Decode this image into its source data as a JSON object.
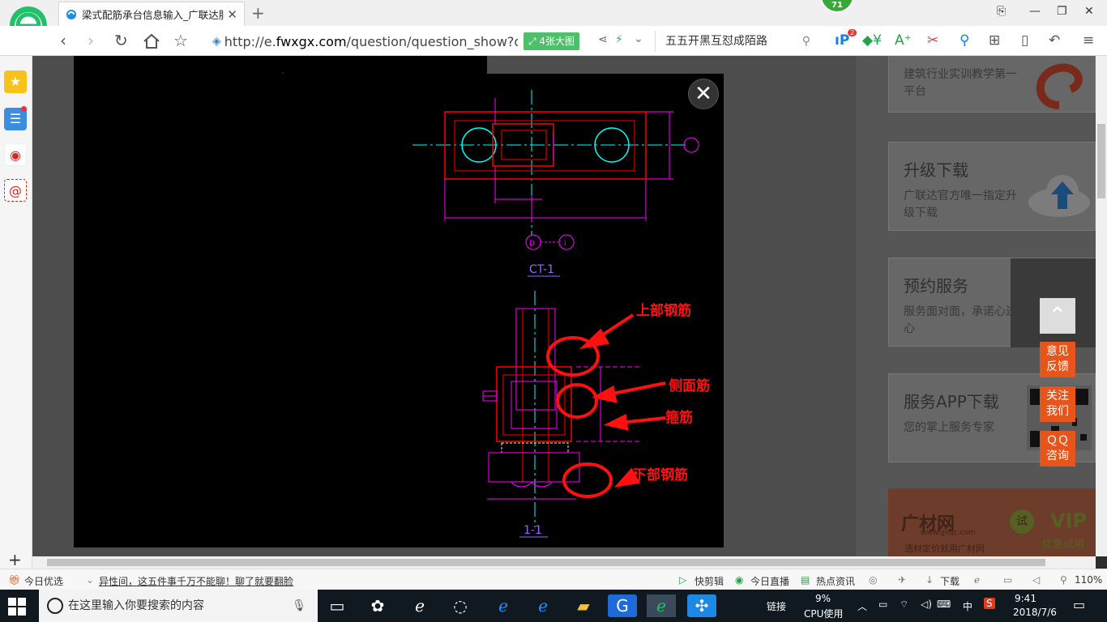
{
  "browser": {
    "tab_title": "梁式配筋承台信息输入_广联达服",
    "tab_close": "✕",
    "new_tab": "+",
    "badge_count": "71",
    "window_controls": [
      "⎘",
      "—",
      "❐",
      "✕"
    ]
  },
  "toolbar": {
    "url_prefix": "http://e.",
    "url_domain": "fwxgx.com",
    "url_rest": "/question/question_show?que",
    "big_image_label": "4张大图",
    "search_text": "五五开黑互怼成陌路",
    "notif_badge": "2"
  },
  "lightbox": {
    "labels": {
      "top_rebar": "上部钢筋",
      "side_rebar": "侧面筋",
      "stirrup": "箍筋",
      "bottom_rebar": "下部钢筋"
    },
    "plan_title": "CT-1",
    "section_title": "1-1",
    "axis_d": "D",
    "axis_i": "i",
    "close": "✕"
  },
  "sidebar_cards": [
    {
      "title": "",
      "desc": "建筑行业实训教学第一平台"
    },
    {
      "title": "升级下载",
      "desc": "广联达官方唯一指定升级下载"
    },
    {
      "title": "预约服务",
      "desc": "服务面对面，承诺心连心"
    },
    {
      "title": "服务APP下载",
      "desc": "您的掌上服务专家"
    }
  ],
  "promo": {
    "brand": "广材网",
    "url": "www.gldjc.com",
    "tagline": "透材定价就用广材网",
    "vip": "VIP",
    "vip_sub": "优惠试用",
    "trial": "试"
  },
  "floating": {
    "feedback": "意见\n反馈",
    "follow": "关注\n我们",
    "qq": "ＱＱ\n咨询"
  },
  "statusbar": {
    "today": "今日优选",
    "news": "异性间，这五件事千万不能聊！聊了就要翻脸",
    "quick_cut": "快剪辑",
    "today_live": "今日直播",
    "hot_news": "热点资讯",
    "download": "下载",
    "zoom": "110%"
  },
  "taskbar": {
    "search_placeholder": "在这里输入你要搜索的内容",
    "link_label": "链接",
    "cpu_percent": "9%",
    "cpu_label": "CPU使用",
    "ime": "中",
    "time": "9:41",
    "date": "2018/7/6"
  },
  "colors": {
    "accent_green": "#4ec06a",
    "annotation_red": "#ff1010",
    "cad_magenta": "#ff00ff",
    "cad_cyan": "#00ffff",
    "cad_red": "#ff0000",
    "float_orange": "#e8551a"
  }
}
